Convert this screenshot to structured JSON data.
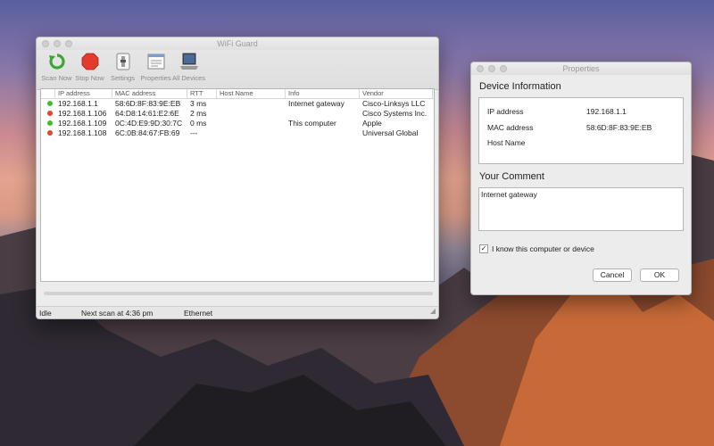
{
  "main_window": {
    "title": "WiFi Guard",
    "toolbar": [
      {
        "label": "Scan Now",
        "icon": "refresh-icon"
      },
      {
        "label": "Stop Now",
        "icon": "stop-icon"
      },
      {
        "label": "Settings",
        "icon": "settings-icon"
      },
      {
        "label": "Properties",
        "icon": "properties-icon"
      },
      {
        "label": "All Devices",
        "icon": "laptop-icon"
      }
    ],
    "columns": [
      "IP address",
      "MAC address",
      "RTT",
      "Host Name",
      "Info",
      "Vendor"
    ],
    "devices": [
      {
        "status": "green",
        "ip": "192.168.1.1",
        "mac": "58:6D:8F:83:9E:EB",
        "rtt": "3 ms",
        "host": "",
        "info": "Internet gateway",
        "vendor": "Cisco-Linksys LLC"
      },
      {
        "status": "red",
        "ip": "192.168.1.106",
        "mac": "64:D8:14:61:E2:6E",
        "rtt": "2 ms",
        "host": "",
        "info": "",
        "vendor": "Cisco Systems Inc."
      },
      {
        "status": "green",
        "ip": "192.168.1.109",
        "mac": "0C:4D:E9:9D:30:7C",
        "rtt": "0 ms",
        "host": "",
        "info": "This computer",
        "vendor": "Apple"
      },
      {
        "status": "red",
        "ip": "192.168.1.108",
        "mac": "6C:0B:84:67:FB:69",
        "rtt": "---",
        "host": "",
        "info": "",
        "vendor": "Universal Global"
      }
    ],
    "status": {
      "state": "Idle",
      "next_scan": "Next scan at 4:36 pm",
      "interface": "Ethernet"
    }
  },
  "properties_window": {
    "title": "Properties",
    "device_info_heading": "Device Information",
    "fields": [
      {
        "label": "IP address",
        "value": "192.168.1.1"
      },
      {
        "label": "MAC address",
        "value": "58:6D:8F:83:9E:EB"
      },
      {
        "label": "Host Name",
        "value": ""
      }
    ],
    "comment_heading": "Your Comment",
    "comment": "Internet gateway",
    "checkbox_label": "I know this computer or device",
    "checkbox_checked": "✓",
    "cancel_label": "Cancel",
    "ok_label": "OK"
  },
  "colors": {
    "status_green": "#3fbf2a",
    "status_red": "#e0472b",
    "stop_red": "#e23c2c",
    "refresh_green": "#3aa82f"
  }
}
